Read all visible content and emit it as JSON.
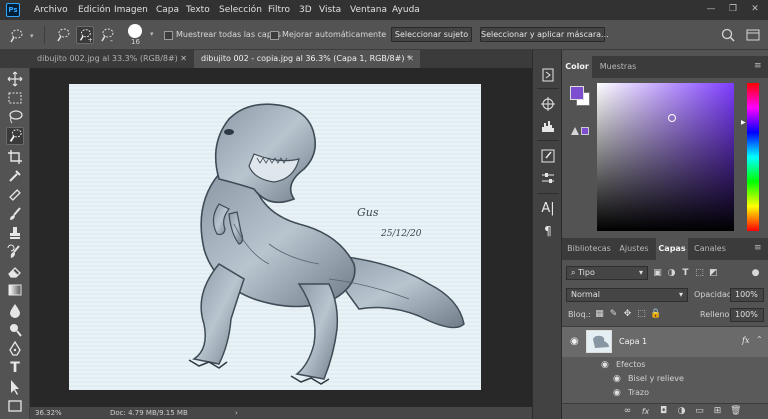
{
  "app": {
    "logo_text": "Ps",
    "menu": [
      "Archivo",
      "Edición",
      "Imagen",
      "Capa",
      "Texto",
      "Selección",
      "Filtro",
      "3D",
      "Vista",
      "Ventana",
      "Ayuda"
    ],
    "window_controls": [
      "—",
      "❐",
      "✕"
    ]
  },
  "options_bar": {
    "brush_size": "16",
    "sample_all_layers_label": "Muestrear todas las capas",
    "auto_enhance_label": "Mejorar automáticamente",
    "select_subject_label": "Seleccionar sujeto",
    "select_mask_label": "Seleccionar y aplicar máscara..."
  },
  "document_tabs": [
    {
      "label": "dibujito 002.jpg al 33.3% (RGB/8#)",
      "active": false
    },
    {
      "label": "dibujito 002 - copia.jpg al 36.3% (Capa 1, RGB/8#) *",
      "active": true
    }
  ],
  "canvas": {
    "signature_text": "Gus",
    "date_text": "25/12/20",
    "paper_color": "#e8f2f6",
    "ink_color": "#4d5a66"
  },
  "status_bar": {
    "zoom": "36.32%",
    "doc_info": "Doc: 4.79 MB/9.15 MB"
  },
  "color_panel": {
    "tabs": [
      "Color",
      "Muestras"
    ],
    "foreground_color": "#7d4fd0",
    "background_color": "#ffffff"
  },
  "layers_panel": {
    "tabs": [
      "Bibliotecas",
      "Ajustes",
      "Capas",
      "Canales"
    ],
    "filter_label": "Tipo",
    "blend_mode": "Normal",
    "opacity_label": "Opacidad:",
    "opacity_value": "100%",
    "lock_label": "Bloq.:",
    "fill_label": "Relleno:",
    "fill_value": "100%",
    "layers": [
      {
        "name": "Capa 1",
        "fx": "fx"
      }
    ],
    "effects_label": "Efectos",
    "effects": [
      "Bisel y relieve",
      "Trazo"
    ]
  }
}
